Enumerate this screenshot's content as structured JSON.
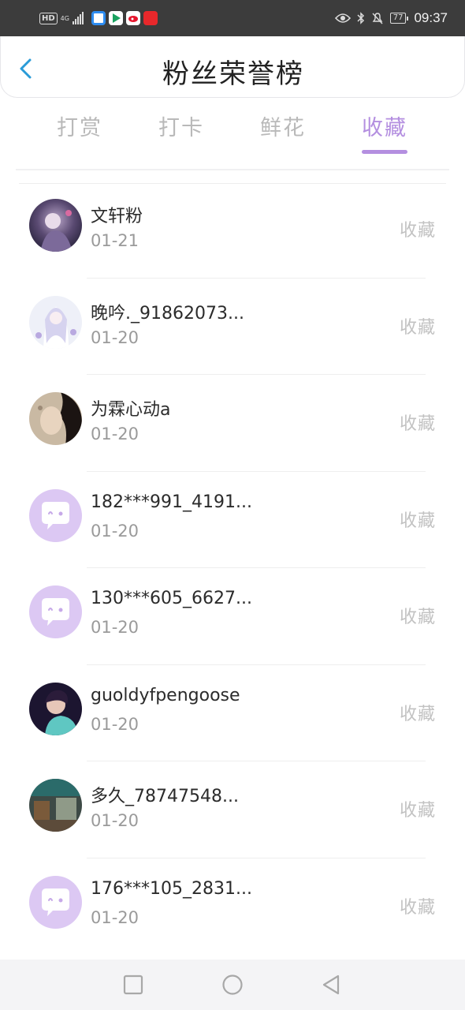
{
  "status_bar": {
    "network_hd": "HD",
    "network_4g": "4G",
    "battery": "77",
    "time": "09:37",
    "icons": [
      "hd-icon",
      "signal-icon",
      "app-icon-browser",
      "app-icon-player",
      "app-icon-weibo",
      "app-icon-xiaohongshu",
      "eye-icon",
      "bluetooth-icon",
      "mute-bell-icon",
      "battery-icon"
    ]
  },
  "header": {
    "title": "粉丝荣誉榜",
    "back_icon": "chevron-left-icon"
  },
  "tabs": [
    {
      "label": "打赏",
      "active": false
    },
    {
      "label": "打卡",
      "active": false
    },
    {
      "label": "鲜花",
      "active": false
    },
    {
      "label": "收藏",
      "active": true
    }
  ],
  "colors": {
    "accent": "#b48fe0",
    "default_avatar_bg": "#dcc8f3"
  },
  "fans": [
    {
      "name": "文轩粉",
      "date": "01-21",
      "action": "收藏",
      "avatar": "photo-anime-dark"
    },
    {
      "name": "晚吟._91862073...",
      "date": "01-20",
      "action": "收藏",
      "avatar": "photo-anime-white"
    },
    {
      "name": "为霖心动a",
      "date": "01-20",
      "action": "收藏",
      "avatar": "photo-portrait"
    },
    {
      "name": "182***991_4191...",
      "date": "01-20",
      "action": "收藏",
      "avatar": "default-chat-avatar"
    },
    {
      "name": "130***605_6627...",
      "date": "01-20",
      "action": "收藏",
      "avatar": "default-chat-avatar"
    },
    {
      "name": "guoldyfpengoose",
      "date": "01-20",
      "action": "收藏",
      "avatar": "photo-person-teal"
    },
    {
      "name": "多久_78747548...",
      "date": "01-20",
      "action": "收藏",
      "avatar": "photo-street"
    },
    {
      "name": "176***105_2831...",
      "date": "01-20",
      "action": "收藏",
      "avatar": "default-chat-avatar"
    }
  ],
  "nav_bar": [
    "square-recent-icon",
    "circle-home-icon",
    "triangle-back-icon"
  ]
}
